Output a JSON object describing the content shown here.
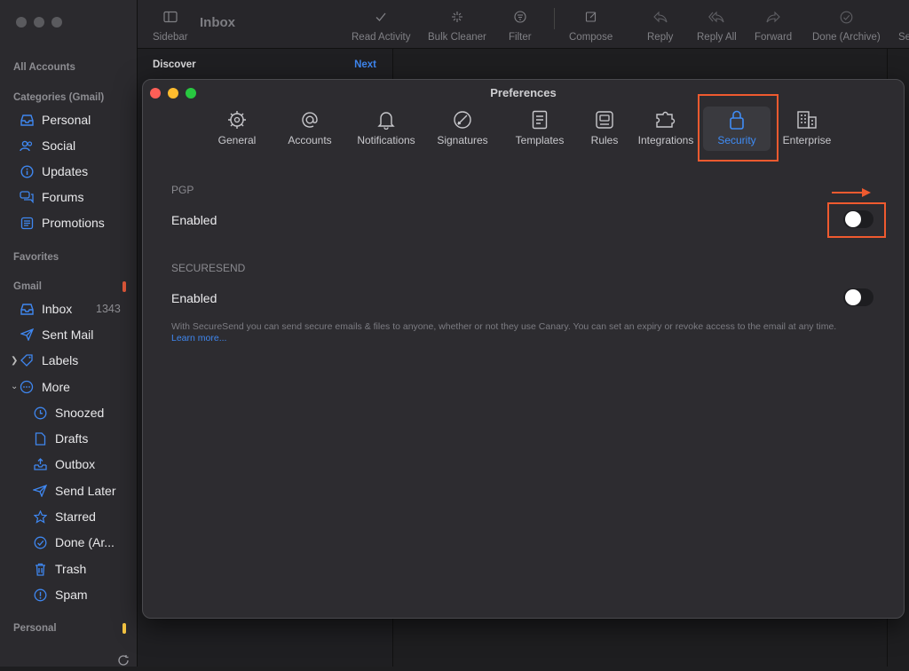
{
  "sidebar": {
    "all_accounts": "All Accounts",
    "categories_heading": "Categories (Gmail)",
    "categories": [
      {
        "label": "Personal",
        "icon": "inbox-tray-icon"
      },
      {
        "label": "Social",
        "icon": "people-icon"
      },
      {
        "label": "Updates",
        "icon": "info-circle-icon"
      },
      {
        "label": "Forums",
        "icon": "chat-bubbles-icon"
      },
      {
        "label": "Promotions",
        "icon": "tag-list-icon"
      }
    ],
    "favorites_heading": "Favorites",
    "gmail_heading": "Gmail",
    "gmail_items": [
      {
        "label": "Inbox",
        "count": "1343",
        "icon": "inbox-tray-icon"
      },
      {
        "label": "Sent Mail",
        "icon": "paper-plane-icon"
      },
      {
        "label": "Labels",
        "icon": "label-tag-icon"
      },
      {
        "label": "More",
        "icon": "ellipsis-circle-icon"
      }
    ],
    "more_items": [
      {
        "label": "Snoozed",
        "icon": "clock-icon"
      },
      {
        "label": "Drafts",
        "icon": "document-icon"
      },
      {
        "label": "Outbox",
        "icon": "outbox-tray-icon"
      },
      {
        "label": "Send Later",
        "icon": "send-later-icon"
      },
      {
        "label": "Starred",
        "icon": "star-icon"
      },
      {
        "label": "Done (Ar...",
        "icon": "checkmark-circle-icon"
      },
      {
        "label": "Trash",
        "icon": "trash-icon"
      },
      {
        "label": "Spam",
        "icon": "exclamation-circle-icon"
      }
    ],
    "personal_heading": "Personal",
    "accent_gmail": "#e0583a",
    "accent_personal": "#f5c542"
  },
  "toolbar": {
    "sidebar_label": "Sidebar",
    "title": "Inbox",
    "read_activity": "Read Activity",
    "bulk_cleaner": "Bulk Cleaner",
    "filter": "Filter",
    "compose": "Compose",
    "reply": "Reply",
    "reply_all": "Reply All",
    "forward": "Forward",
    "done_archive": "Done (Archive)",
    "cut_off": "Se"
  },
  "list": {
    "discover": "Discover",
    "next": "Next"
  },
  "preferences": {
    "title": "Preferences",
    "tabs": [
      {
        "label": "General",
        "icon": "gear-icon"
      },
      {
        "label": "Accounts",
        "icon": "at-sign-icon"
      },
      {
        "label": "Notifications",
        "icon": "bell-icon"
      },
      {
        "label": "Signatures",
        "icon": "signature-pen-icon"
      },
      {
        "label": "Templates",
        "icon": "template-doc-icon"
      },
      {
        "label": "Rules",
        "icon": "rules-icon"
      },
      {
        "label": "Integrations",
        "icon": "puzzle-icon"
      },
      {
        "label": "Security",
        "icon": "lock-icon"
      },
      {
        "label": "Enterprise",
        "icon": "building-icon"
      }
    ],
    "active_tab": "Security",
    "pgp_heading": "PGP",
    "pgp_enabled_label": "Enabled",
    "pgp_enabled": false,
    "securesend_heading": "SECURESEND",
    "securesend_enabled_label": "Enabled",
    "securesend_enabled": false,
    "securesend_desc": "With SecureSend you can send secure emails & files to anyone, whether or not they use Canary. You can set an expiry or revoke access to the email at any time.",
    "learn_more": "Learn more...",
    "accent": "#3f8cf6",
    "highlight": "#ef5a2f"
  }
}
